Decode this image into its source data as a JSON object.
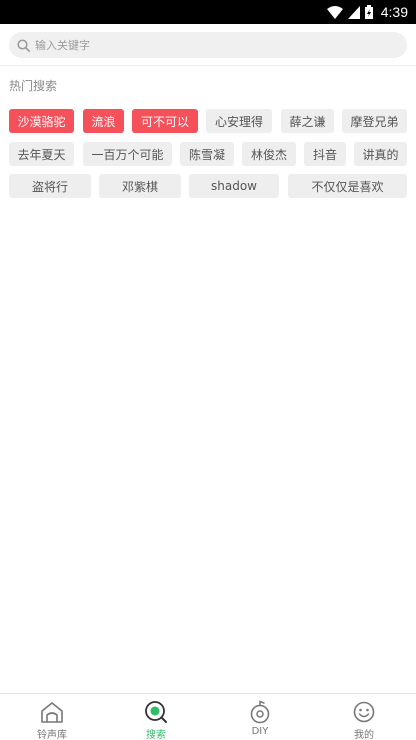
{
  "status_bar": {
    "time": "4:39",
    "icons": [
      "wifi-icon",
      "cell-signal-icon",
      "battery-icon"
    ]
  },
  "search": {
    "placeholder": "输入关键字",
    "value": ""
  },
  "hot_search": {
    "title": "热门搜索",
    "tags": [
      {
        "label": "沙漠骆驼",
        "hot": true
      },
      {
        "label": "流浪",
        "hot": true
      },
      {
        "label": "可不可以",
        "hot": true
      },
      {
        "label": "心安理得",
        "hot": false
      },
      {
        "label": "薛之谦",
        "hot": false
      },
      {
        "label": "摩登兄弟",
        "hot": false
      },
      {
        "label": "去年夏天",
        "hot": false
      },
      {
        "label": "一百万个可能",
        "hot": false
      },
      {
        "label": "陈雪凝",
        "hot": false
      },
      {
        "label": "林俊杰",
        "hot": false
      },
      {
        "label": "抖音",
        "hot": false
      },
      {
        "label": "讲真的",
        "hot": false
      },
      {
        "label": "盗将行",
        "hot": false
      },
      {
        "label": "邓紫棋",
        "hot": false
      },
      {
        "label": "shadow",
        "hot": false
      },
      {
        "label": "不仅仅是喜欢",
        "hot": false
      }
    ]
  },
  "tabbar": {
    "tabs": [
      {
        "label": "铃声库",
        "icon": "home-icon",
        "active": false
      },
      {
        "label": "搜索",
        "icon": "search-icon",
        "active": true
      },
      {
        "label": "DIY",
        "icon": "diy-icon",
        "active": false
      },
      {
        "label": "我的",
        "icon": "smiley-icon",
        "active": false
      }
    ]
  },
  "colors": {
    "hot_tag": "#f4515b",
    "tag_bg": "#eeeeee",
    "accent": "#2fbd6a"
  }
}
